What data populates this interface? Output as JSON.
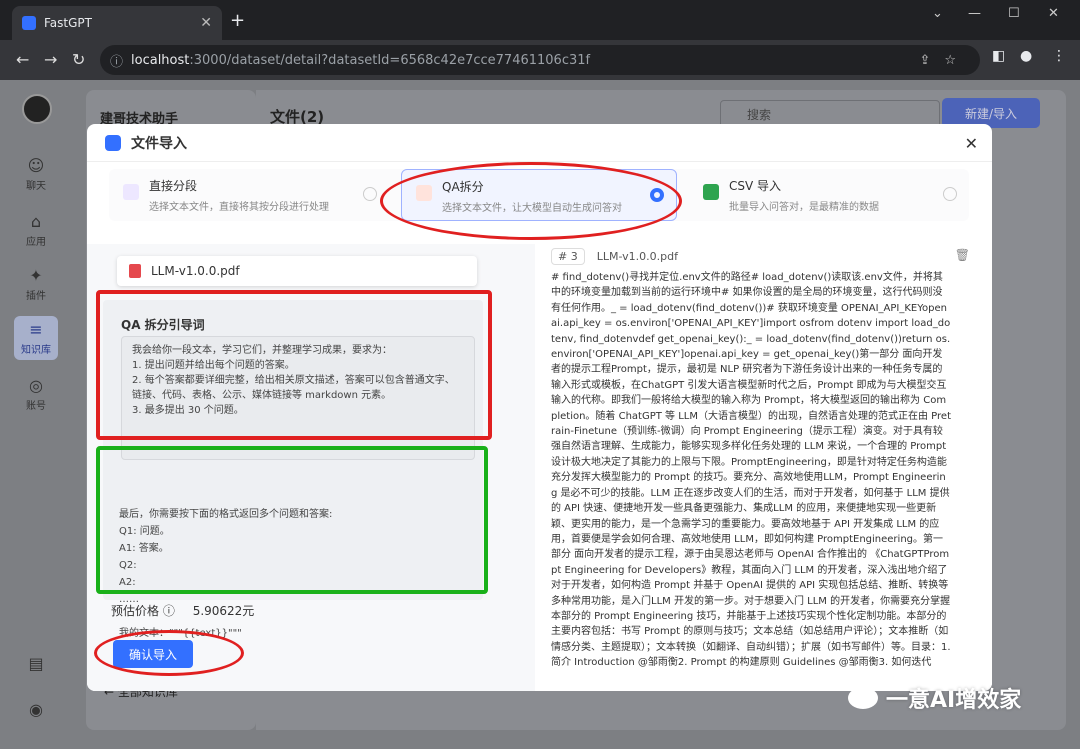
{
  "browser": {
    "tab_title": "FastGPT",
    "url_host": "localhost",
    "url_rest": ":3000/dataset/detail?datasetId=6568c42e7cce77461106c31f"
  },
  "sidebar": {
    "items": [
      {
        "label": "聊天",
        "icon": "chat-icon"
      },
      {
        "label": "应用",
        "icon": "robot-icon"
      },
      {
        "label": "插件",
        "icon": "puzzle-icon"
      },
      {
        "label": "知识库",
        "icon": "database-icon"
      },
      {
        "label": "账号",
        "icon": "user-icon"
      }
    ]
  },
  "background": {
    "kb_name": "建哥技术助手",
    "files_title": "文件(2)",
    "search_placeholder": "搜索",
    "new_import": "新建/导入",
    "back_all": "全部知识库"
  },
  "modal": {
    "title": "文件导入",
    "options": [
      {
        "title": "直接分段",
        "desc": "选择文本文件，直接将其按分段进行处理",
        "selected": false
      },
      {
        "title": "QA拆分",
        "desc": "选择文本文件，让大模型自动生成问答对",
        "selected": true
      },
      {
        "title": "CSV 导入",
        "desc": "批量导入问答对，是最精准的数据",
        "selected": false
      }
    ],
    "file_name": "LLM-v1.0.0.pdf",
    "prompt_title": "QA 拆分引导词",
    "prompt_text": "我会给你一段文本，学习它们，并整理学习成果，要求为：\n1. 提出问题并给出每个问题的答案。\n2. 每个答案都要详细完整，给出相关原文描述，答案可以包含普通文字、链接、代码、表格、公示、媒体链接等 markdown 元素。\n3. 最多提出 30 个问题。",
    "fixed_text": "最后，你需要按下面的格式返回多个问题和答案:\nQ1: 问题。\nA1: 答案。\nQ2:\nA2:\n……\n\n我的文本：\"\"\"{{text}}\"\"\"",
    "price_label": "预估价格",
    "price_value": "5.90622元",
    "confirm_label": "确认导入",
    "preview_index": "# 3",
    "preview_file": "LLM-v1.0.0.pdf",
    "preview_text": "# find_dotenv()寻找并定位.env文件的路径# load_dotenv()读取该.env文件，并将其中的环境变量加载到当前的运行环境中# 如果你设置的是全局的环境变量，这行代码则没有任何作用。_ = load_dotenv(find_dotenv())# 获取环境变量 OPENAI_API_KEYopenai.api_key = os.environ['OPENAI_API_KEY']import osfrom dotenv import load_dotenv, find_dotenvdef get_openai_key():_ = load_dotenv(find_dotenv())return os.environ['OPENAI_API_KEY']openai.api_key = get_openai_key()第一部分 面向开发者的提示工程Prompt，提示，最初是 NLP 研究者为下游任务设计出来的一种任务专属的输入形式或模板，在ChatGPT 引发大语言模型新时代之后，Prompt 即成为与大模型交互输入的代称。即我们一般将给大模型的输入称为 Prompt，将大模型返回的输出称为 Completion。随着 ChatGPT 等 LLM（大语言模型）的出现，自然语言处理的范式正在由 Pretrain-Finetune（预训练-微调）向 Prompt Engineering（提示工程）演变。对于具有较强自然语言理解、生成能力，能够实现多样化任务处理的 LLM 来说，一个合理的 Prompt 设计极大地决定了其能力的上限与下限。PromptEngineering，即是针对特定任务构造能充分发挥大模型能力的 Prompt 的技巧。要充分、高效地使用LLM，Prompt Engineering 是必不可少的技能。LLM 正在逐步改变人们的生活，而对于开发者，如何基于 LLM 提供的 API 快速、便捷地开发一些具备更强能力、集成LLM 的应用，来便捷地实现一些更新颖、更实用的能力，是一个急需学习的重要能力。要高效地基于 API 开发集成 LLM 的应用，首要便是学会如何合理、高效地使用 LLM，即如何构建 PromptEngineering。第一部分 面向开发者的提示工程，源于由吴恩达老师与 OpenAI 合作推出的 《ChatGPTPrompt Engineering for Developers》教程，其面向入门 LLM 的开发者，深入浅出地介绍了对于开发者，如何构造 Prompt 并基于 OpenAI 提供的 API 实现包括总结、推断、转换等多种常用功能，是入门LLM 开发的第一步。对于想要入门 LLM 的开发者，你需要充分掌握本部分的 Prompt Engineering 技巧，并能基于上述技巧实现个性化定制功能。本部分的主要内容包括：书写 Prompt 的原则与技巧；文本总结（如总结用户评论）；文本推断（如情感分类、主题提取）；文本转换（如翻译、自动纠错）；扩展（如书写邮件）等。目录：1. 简介 Introduction @邹雨衡2. Prompt 的构建原则 Guidelines @邹雨衡3. 如何迭代"
  },
  "watermark": "一意AI增效家"
}
